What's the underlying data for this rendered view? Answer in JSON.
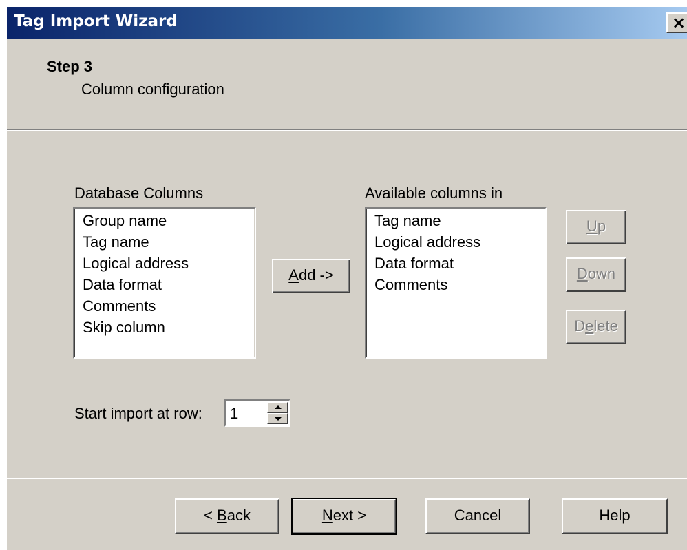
{
  "window": {
    "title": "Tag Import Wizard",
    "close_glyph": "×"
  },
  "header": {
    "step": "Step 3",
    "subtitle": "Column configuration"
  },
  "database_columns": {
    "label": "Database Columns",
    "items": [
      "Group name",
      "Tag name",
      "Logical address",
      "Data format",
      "Comments",
      "Skip column"
    ]
  },
  "available_columns": {
    "label": "Available columns in",
    "items": [
      "Tag name",
      "Logical address",
      "Data format",
      "Comments"
    ]
  },
  "buttons": {
    "add": {
      "mnemonic": "A",
      "rest": "dd ->"
    },
    "up": {
      "mnemonic": "U",
      "rest": "p"
    },
    "down": {
      "mnemonic": "D",
      "rest": "own"
    },
    "delete": {
      "pre": "D",
      "mnemonic": "e",
      "rest": "lete"
    },
    "back": {
      "pre": "< ",
      "mnemonic": "B",
      "rest": "ack"
    },
    "next": {
      "mnemonic": "N",
      "rest": "ext >"
    },
    "cancel": "Cancel",
    "help": "Help"
  },
  "start_row": {
    "label": "Start import at row:",
    "value": "1"
  },
  "colors": {
    "face": "#d4d0c8",
    "title_gradient_start": "#0a246a",
    "title_gradient_end": "#a6caf0",
    "disabled_text": "#808080"
  },
  "icons": {
    "close": "close-icon",
    "spin_up": "spin-up-arrow-icon",
    "spin_down": "spin-down-arrow-icon"
  }
}
